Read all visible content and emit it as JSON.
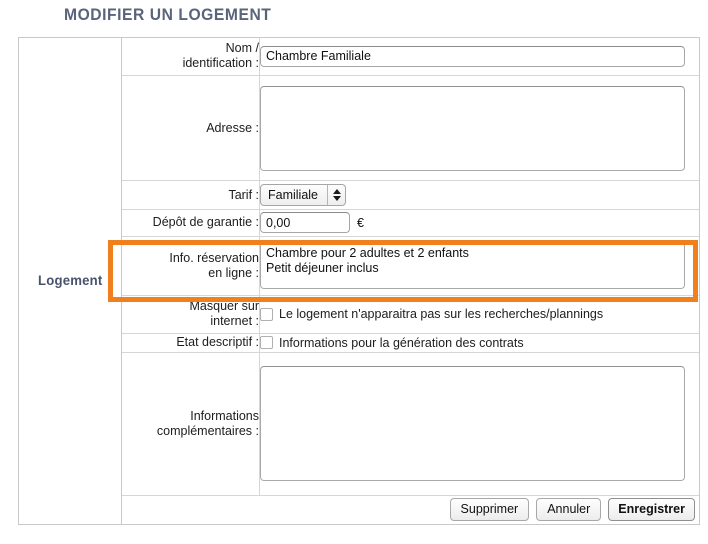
{
  "page": {
    "title": "MODIFIER UN LOGEMENT",
    "title_color": "#59637a",
    "highlight_color": "#f07f1e"
  },
  "section": {
    "label": "Logement"
  },
  "fields": {
    "nom": {
      "label": "Nom / identification :",
      "label_line1": "Nom /",
      "label_line2": "identification :",
      "value": "Chambre Familiale"
    },
    "adresse": {
      "label": "Adresse :",
      "value": ""
    },
    "tarif": {
      "label": "Tarif :",
      "value": "Familiale"
    },
    "depot": {
      "label": "Dépôt de garantie :",
      "value": "0,00",
      "unit": "€"
    },
    "info_reservation": {
      "label_line1": "Info. réservation",
      "label_line2": "en ligne :",
      "value": "Chambre pour 2 adultes et 2 enfants\nPetit déjeuner inclus",
      "highlighted": true
    },
    "masquer": {
      "label_line1": "Masquer sur",
      "label_line2": "internet :",
      "checkbox_label": "Le logement n'apparaitra pas sur les recherches/plannings",
      "checked": false
    },
    "etat_descriptif": {
      "label": "Etat descriptif :",
      "checkbox_label": "Informations pour la génération des contrats",
      "checked": false
    },
    "informations_complementaires": {
      "label_line1": "Informations",
      "label_line2": "complémentaires :",
      "value": ""
    }
  },
  "actions": {
    "delete_label": "Supprimer",
    "cancel_label": "Annuler",
    "save_label": "Enregistrer"
  }
}
